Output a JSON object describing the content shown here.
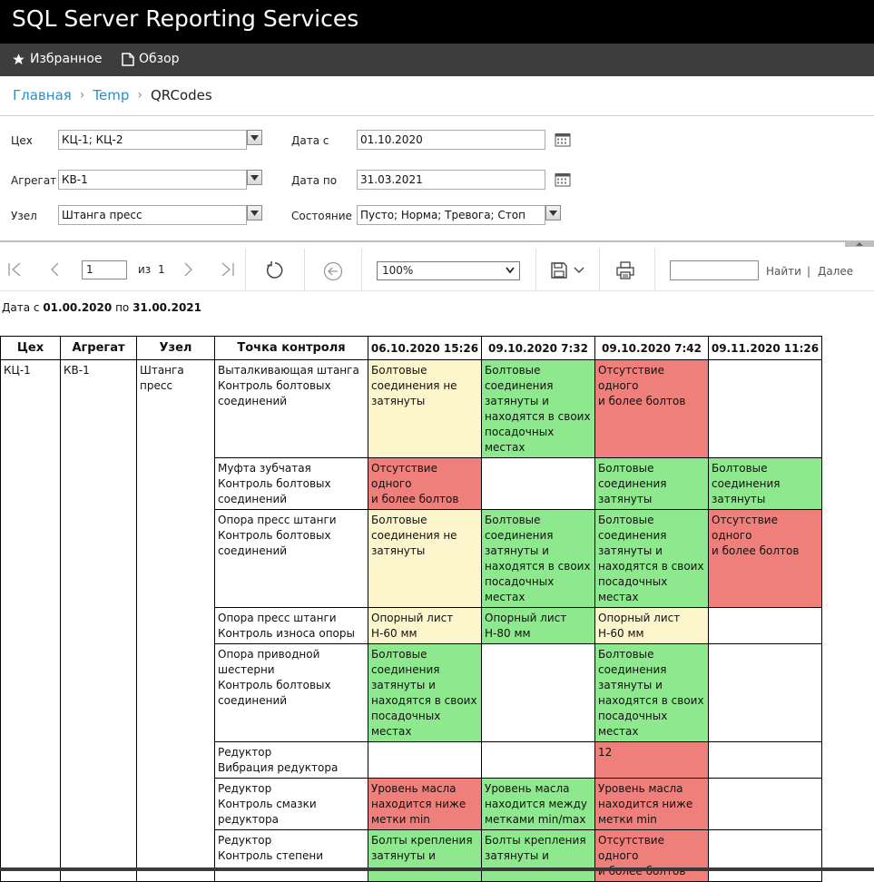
{
  "app": {
    "title": "SQL Server Reporting Services"
  },
  "nav": {
    "favorites": "Избранное",
    "browse": "Обзор"
  },
  "breadcrumb": {
    "home": "Главная",
    "folder": "Temp",
    "current": "QRCodes"
  },
  "params": {
    "shop_label": "Цех",
    "shop_value": "КЦ-1; КЦ-2",
    "unit_label": "Агрегат",
    "unit_value": "КВ-1",
    "node_label": "Узел",
    "node_value": "Штанга пресс",
    "date_from_label": "Дата с",
    "date_from_value": "01.10.2020",
    "date_to_label": "Дата по",
    "date_to_value": "31.03.2021",
    "state_label": "Состояние",
    "state_value": "Пусто; Норма; Тревога; Стоп"
  },
  "toolbar": {
    "page_value": "1",
    "of_label": "из",
    "total_pages": "1",
    "zoom_value": "100%",
    "find_label": "Найти",
    "divider": "|",
    "next_label": "Далее"
  },
  "report": {
    "header_prefix": "Дата с",
    "date_from": "01.00.2020",
    "header_mid": "по",
    "date_to": "31.00.2021",
    "columns": [
      "Цех",
      "Агрегат",
      "Узел",
      "Точка контроля",
      "06.10.2020 15:26",
      "09.10.2020 7:32",
      "09.10.2020 7:42",
      "09.11.2020 11:26"
    ],
    "shop": "КЦ-1",
    "unit": "КВ-1",
    "node": "Штанга\nпресс",
    "colors": {
      "yellow": "#fdf5cc",
      "green": "#8ee88e",
      "red": "#ef7f7b",
      "white": "#ffffff"
    },
    "rows": [
      {
        "point": "Выталкивающая штанга\nКонтроль болтовых\nсоединений",
        "cells": [
          {
            "text": "Болтовые\nсоединения не\nзатянуты",
            "status": "yellow"
          },
          {
            "text": "Болтовые\nсоединения\nзатянуты и\nнаходятся в своих\nпосадочных\nместах",
            "status": "green"
          },
          {
            "text": "Отсутствие одного\nи более болтов",
            "status": "red"
          },
          {
            "text": "",
            "status": "white"
          }
        ]
      },
      {
        "point": "Муфта зубчатая\nКонтроль болтовых\nсоединений",
        "cells": [
          {
            "text": "Отсутствие одного\nи более болтов",
            "status": "red"
          },
          {
            "text": "",
            "status": "white"
          },
          {
            "text": "Болтовые\nсоединения\nзатянуты",
            "status": "green"
          },
          {
            "text": "Болтовые\nсоединения\nзатянуты",
            "status": "green"
          }
        ]
      },
      {
        "point": "Опора пресс штанги\nКонтроль болтовых\nсоединений",
        "cells": [
          {
            "text": "Болтовые\nсоединения не\nзатянуты",
            "status": "yellow"
          },
          {
            "text": "Болтовые\nсоединения\nзатянуты и\nнаходятся в своих\nпосадочных\nместах",
            "status": "green"
          },
          {
            "text": "Болтовые\nсоединения\nзатянуты и\nнаходятся в своих\nпосадочных\nместах",
            "status": "green"
          },
          {
            "text": "Отсутствие одного\nи более болтов",
            "status": "red"
          }
        ]
      },
      {
        "point": "Опора пресс штанги\nКонтроль износа опоры",
        "cells": [
          {
            "text": "Опорный лист\nН-60 мм",
            "status": "yellow"
          },
          {
            "text": "Опорный лист\nН-80 мм",
            "status": "green"
          },
          {
            "text": "Опорный лист\nН-60 мм",
            "status": "yellow"
          },
          {
            "text": "",
            "status": "white"
          }
        ]
      },
      {
        "point": "Опора приводной\nшестерни\nКонтроль болтовых\nсоединений",
        "cells": [
          {
            "text": "Болтовые\nсоединения\nзатянуты и\nнаходятся в своих\nпосадочных\nместах",
            "status": "green"
          },
          {
            "text": "",
            "status": "white"
          },
          {
            "text": "Болтовые\nсоединения\nзатянуты и\nнаходятся в своих\nпосадочных\nместах",
            "status": "green"
          },
          {
            "text": "",
            "status": "white"
          }
        ]
      },
      {
        "point": "Редуктор\nВибрация редуктора",
        "cells": [
          {
            "text": "",
            "status": "white"
          },
          {
            "text": "",
            "status": "white"
          },
          {
            "text": "12",
            "status": "red"
          },
          {
            "text": "",
            "status": "white"
          }
        ]
      },
      {
        "point": "Редуктор\nКонтроль  смазки\nредуктора",
        "cells": [
          {
            "text": " Уровень масла\nнаходится ниже\nметки min",
            "status": "red"
          },
          {
            "text": " Уровень масла\nнаходится между\nметками min/max",
            "status": "green"
          },
          {
            "text": " Уровень масла\nнаходится ниже\nметки min",
            "status": "red"
          },
          {
            "text": "",
            "status": "white"
          }
        ]
      },
      {
        "point": "Редуктор\nКонтроль степени",
        "cells": [
          {
            "text": "Болты крепления\nзатянуты и",
            "status": "green"
          },
          {
            "text": "Болты крепления\nзатянуты и",
            "status": "green"
          },
          {
            "text": "Отсутствие одного\nи более болтов",
            "status": "red"
          },
          {
            "text": "",
            "status": "white"
          }
        ]
      }
    ]
  }
}
